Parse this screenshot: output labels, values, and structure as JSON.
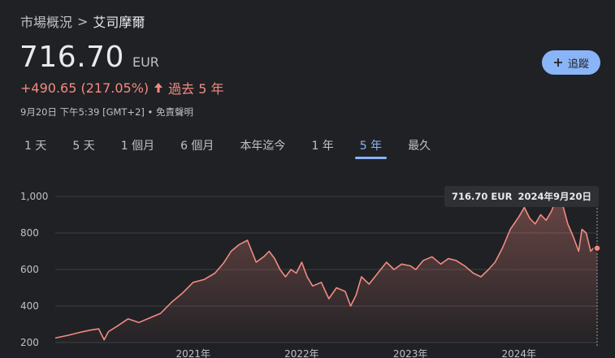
{
  "breadcrumb": {
    "parent": "市場概況",
    "separator": ">",
    "current": "艾司摩爾"
  },
  "quote": {
    "price": "716.70",
    "currency": "EUR",
    "change": "+490.65 (217.05%)",
    "period": "過去 5 年",
    "timestamp": "9月20日 下午5:39 [GMT+2] • 免責聲明"
  },
  "follow_button": {
    "label": "追蹤"
  },
  "tabs": [
    "1 天",
    "5 天",
    "1 個月",
    "6 個月",
    "本年迄今",
    "1 年",
    "5 年",
    "最久"
  ],
  "active_tab_index": 6,
  "tooltip": {
    "price": "716.70 EUR",
    "date": "2024年9月20日"
  },
  "colors": {
    "line": "#f28b82",
    "accent": "#8ab4f8",
    "negative": "#f28b82"
  },
  "chart_data": {
    "type": "area",
    "ylim": [
      200,
      1000
    ],
    "yticks": [
      200,
      400,
      600,
      800,
      1000
    ],
    "ytick_labels": [
      "200",
      "400",
      "600",
      "800",
      "1,000"
    ],
    "xlim": [
      2019.73,
      2024.72
    ],
    "xticks": [
      2021,
      2022,
      2023,
      2024
    ],
    "xtick_labels": [
      "2021年",
      "2022年",
      "2023年",
      "2024年"
    ],
    "x": [
      2019.73,
      2019.85,
      2019.95,
      2020.05,
      2020.13,
      2020.18,
      2020.22,
      2020.3,
      2020.4,
      2020.5,
      2020.6,
      2020.7,
      2020.8,
      2020.9,
      2021.0,
      2021.1,
      2021.2,
      2021.28,
      2021.35,
      2021.42,
      2021.5,
      2021.58,
      2021.65,
      2021.7,
      2021.75,
      2021.8,
      2021.85,
      2021.9,
      2021.95,
      2022.0,
      2022.05,
      2022.1,
      2022.18,
      2022.25,
      2022.32,
      2022.4,
      2022.45,
      2022.5,
      2022.55,
      2022.62,
      2022.7,
      2022.78,
      2022.85,
      2022.92,
      2023.0,
      2023.05,
      2023.12,
      2023.2,
      2023.28,
      2023.35,
      2023.42,
      2023.5,
      2023.58,
      2023.65,
      2023.72,
      2023.78,
      2023.85,
      2023.92,
      2024.0,
      2024.05,
      2024.1,
      2024.15,
      2024.2,
      2024.25,
      2024.3,
      2024.35,
      2024.4,
      2024.45,
      2024.5,
      2024.55,
      2024.58,
      2024.62,
      2024.66,
      2024.69,
      2024.72
    ],
    "values": [
      225,
      240,
      255,
      268,
      275,
      215,
      260,
      290,
      330,
      310,
      335,
      360,
      420,
      470,
      530,
      545,
      580,
      635,
      700,
      735,
      760,
      640,
      670,
      700,
      660,
      600,
      560,
      600,
      580,
      640,
      560,
      510,
      530,
      440,
      500,
      480,
      400,
      460,
      560,
      520,
      580,
      640,
      600,
      630,
      620,
      600,
      650,
      670,
      630,
      660,
      650,
      620,
      580,
      560,
      600,
      640,
      720,
      820,
      890,
      940,
      880,
      850,
      900,
      870,
      920,
      1000,
      960,
      850,
      780,
      700,
      820,
      800,
      700,
      720,
      716.7
    ]
  }
}
